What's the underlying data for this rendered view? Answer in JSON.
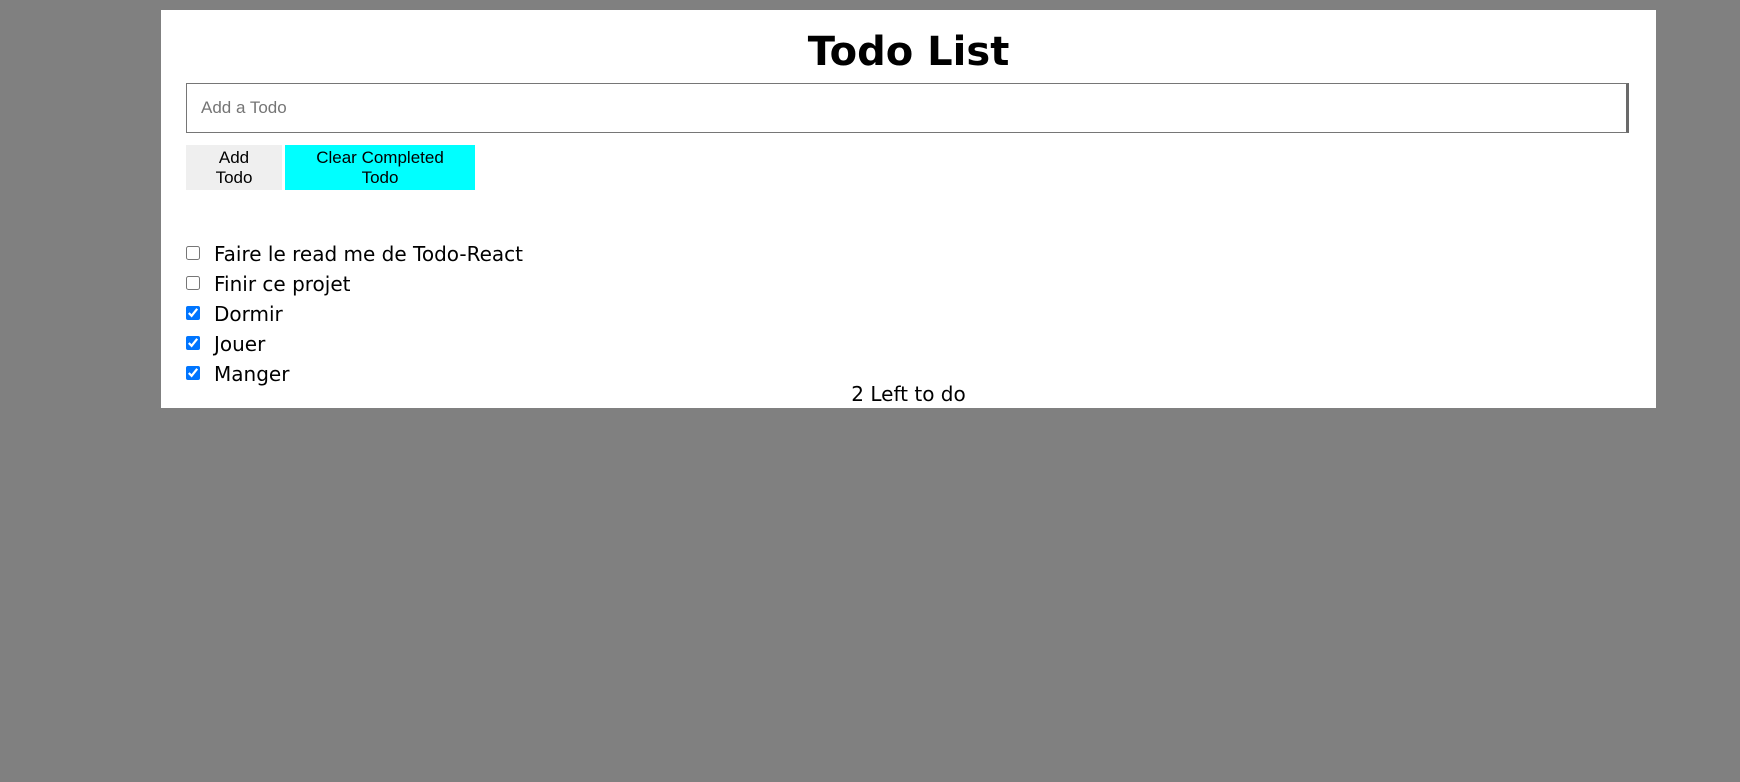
{
  "header": {
    "title": "Todo List"
  },
  "form": {
    "input_value": "",
    "input_placeholder": "Add a Todo",
    "add_label": "Add Todo",
    "clear_label": "Clear Completed Todo"
  },
  "todos": [
    {
      "label": "Faire le read me de Todo-React",
      "checked": false
    },
    {
      "label": "Finir ce projet",
      "checked": false
    },
    {
      "label": "Dormir",
      "checked": true
    },
    {
      "label": "Jouer",
      "checked": true
    },
    {
      "label": "Manger",
      "checked": true
    }
  ],
  "footer": {
    "remaining_text": "2 Left to do"
  },
  "colors": {
    "background": "#808080",
    "panel": "#ffffff",
    "add_button": "#efefef",
    "clear_button": "#00ffff"
  }
}
